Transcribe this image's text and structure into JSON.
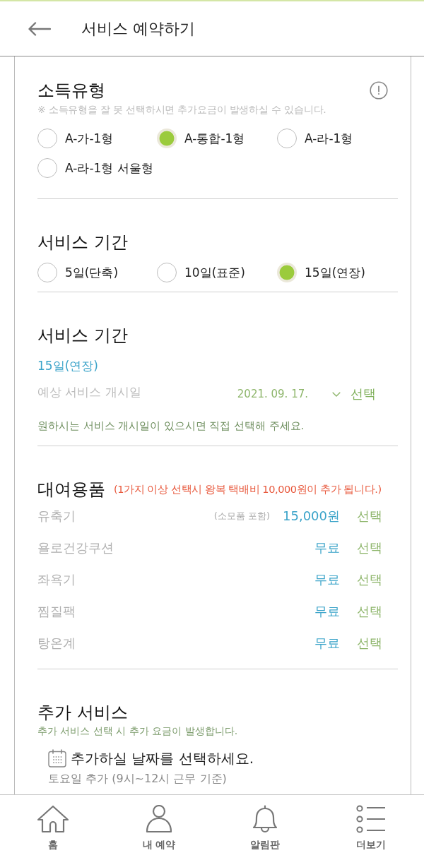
{
  "header": {
    "title": "서비스 예약하기"
  },
  "income_type": {
    "title": "소득유형",
    "note": "※ 소득유형을 잘 못 선택하시면 추가요금이 발생하실 수 있습니다.",
    "options": [
      {
        "label": "A-가-1형",
        "selected": false
      },
      {
        "label": "A-통합-1형",
        "selected": true
      },
      {
        "label": "A-라-1형",
        "selected": false
      },
      {
        "label": "A-라-1형 서울형",
        "selected": false
      }
    ]
  },
  "service_period": {
    "title": "서비스 기간",
    "options": [
      {
        "label": "5일(단축)",
        "selected": false
      },
      {
        "label": "10일(표준)",
        "selected": false
      },
      {
        "label": "15일(연장)",
        "selected": true
      }
    ]
  },
  "service_schedule": {
    "title": "서비스 기간",
    "period": "15일(연장)",
    "start_label": "예상 서비스 개시일",
    "start_date": "2021. 09. 17.",
    "select_button": "선택",
    "note": "원하시는 서비스 개시일이 있으시면 직접 선택해 주세요."
  },
  "rentals": {
    "title": "대여용품",
    "note": "(1가지 이상 선택시 왕복 택배비 10,000원이 추가 됩니다.)",
    "items": [
      {
        "name": "유축기",
        "detail": "(소모품 포함)",
        "price": "15,000원",
        "button": "선택"
      },
      {
        "name": "욜로건강쿠션",
        "price": "무료",
        "button": "선택"
      },
      {
        "name": "좌욕기",
        "price": "무료",
        "button": "선택"
      },
      {
        "name": "찜질팩",
        "price": "무료",
        "button": "선택"
      },
      {
        "name": "탕온계",
        "price": "무료",
        "button": "선택"
      }
    ]
  },
  "extra_service": {
    "title": "추가 서비스",
    "note": "추가 서비스 선택 시 추가 요금이 발생합니다.",
    "date_prompt": "추가하실 날짜를 선택하세요.",
    "option": "토요일 추가 (9시~12시 근무 기준)"
  },
  "bottom_nav": [
    {
      "label": "홈"
    },
    {
      "label": "내 예약"
    },
    {
      "label": "알림판"
    },
    {
      "label": "더보기"
    }
  ]
}
